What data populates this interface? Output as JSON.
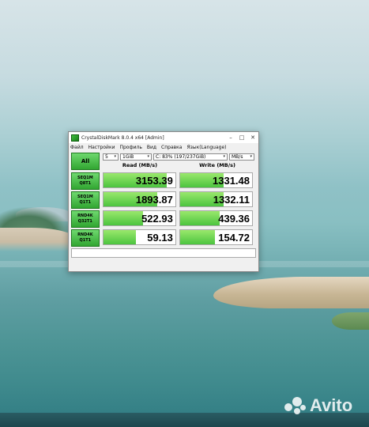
{
  "window": {
    "title": "CrystalDiskMark 8.0.4 x64 [Admin]",
    "controls": [
      "–",
      "□",
      "✕"
    ]
  },
  "menu": [
    "Файл",
    "Настройки",
    "Профиль",
    "Вид",
    "Справка",
    "Язык(Language)"
  ],
  "toolbar": {
    "all_label": "All",
    "count": "5",
    "size": "1GiB",
    "drive": "C: 83% (197/237GiB)",
    "unit": "MB/s"
  },
  "headers": {
    "read": "Read (MB/s)",
    "write": "Write (MB/s)"
  },
  "tests": [
    {
      "line1": "SEQ1M",
      "line2": "Q8T1",
      "read": "3153.39",
      "write": "1331.48",
      "read_fill": 0.88,
      "write_fill": 0.6
    },
    {
      "line1": "SEQ1M",
      "line2": "Q1T1",
      "read": "1893.87",
      "write": "1332.11",
      "read_fill": 0.75,
      "write_fill": 0.6
    },
    {
      "line1": "RND4K",
      "line2": "Q32T1",
      "read": "522.93",
      "write": "439.36",
      "read_fill": 0.55,
      "write_fill": 0.55
    },
    {
      "line1": "RND4K",
      "line2": "Q1T1",
      "read": "59.13",
      "write": "154.72",
      "read_fill": 0.45,
      "write_fill": 0.48
    }
  ],
  "status": "",
  "watermark": {
    "brand": "Avito"
  }
}
